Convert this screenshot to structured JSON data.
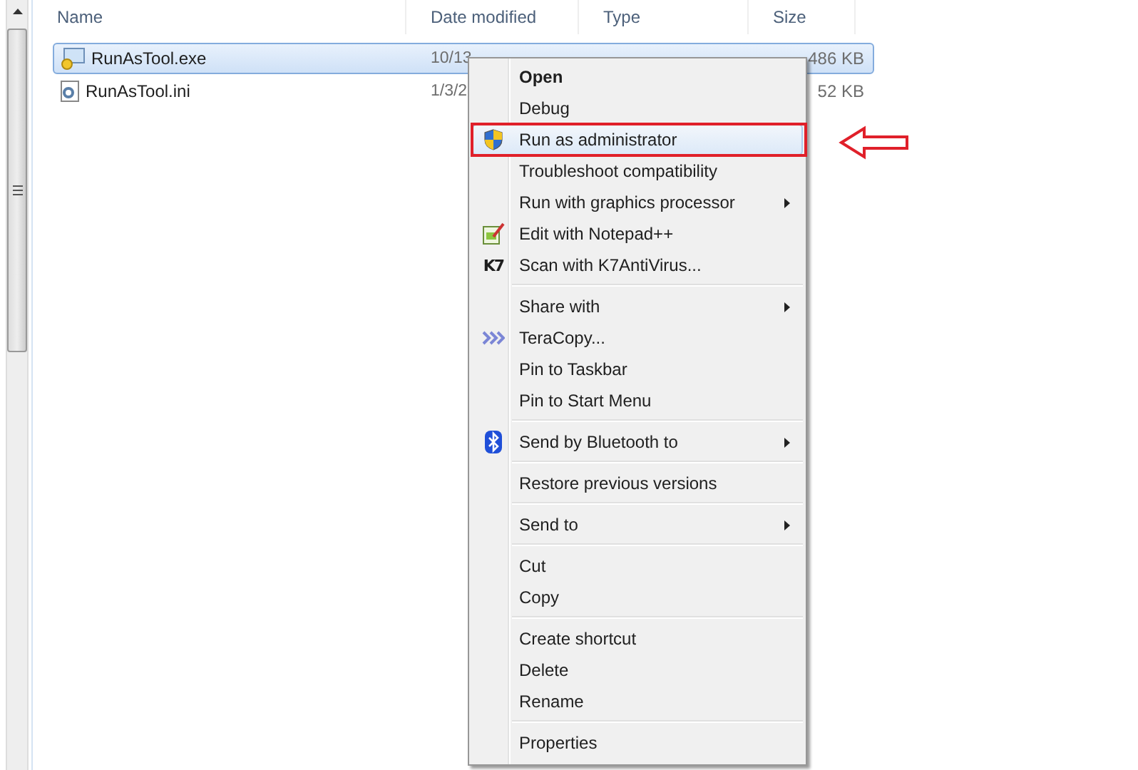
{
  "columns": [
    {
      "label": "Name"
    },
    {
      "label": "Date modified"
    },
    {
      "label": "Type"
    },
    {
      "label": "Size"
    }
  ],
  "files": [
    {
      "name": "RunAsTool.exe",
      "date": "10/13",
      "size": "486 KB",
      "selected": true
    },
    {
      "name": "RunAsTool.ini",
      "date": "1/3/2",
      "size": "52 KB",
      "selected": false
    }
  ],
  "context_menu": [
    {
      "kind": "item",
      "label": "Open",
      "bold": true,
      "submenu": false,
      "selected": false
    },
    {
      "kind": "item",
      "label": "Debug",
      "bold": false,
      "submenu": false,
      "selected": false
    },
    {
      "kind": "item",
      "label": "Run as administrator",
      "bold": false,
      "submenu": false,
      "selected": true
    },
    {
      "kind": "item",
      "label": "Troubleshoot compatibility",
      "bold": false,
      "submenu": false,
      "selected": false
    },
    {
      "kind": "item",
      "label": "Run with graphics processor",
      "bold": false,
      "submenu": true,
      "selected": false
    },
    {
      "kind": "item",
      "label": "Edit with Notepad++",
      "bold": false,
      "submenu": false,
      "selected": false
    },
    {
      "kind": "item",
      "label": "Scan with K7AntiVirus...",
      "badge": "K7",
      "bold": false,
      "submenu": false,
      "selected": false
    },
    {
      "kind": "separator"
    },
    {
      "kind": "item",
      "label": "Share with",
      "bold": false,
      "submenu": true,
      "selected": false
    },
    {
      "kind": "item",
      "label": "TeraCopy...",
      "bold": false,
      "submenu": false,
      "selected": false
    },
    {
      "kind": "item",
      "label": "Pin to Taskbar",
      "bold": false,
      "submenu": false,
      "selected": false
    },
    {
      "kind": "item",
      "label": "Pin to Start Menu",
      "bold": false,
      "submenu": false,
      "selected": false
    },
    {
      "kind": "separator"
    },
    {
      "kind": "item",
      "label": "Send by Bluetooth to",
      "bold": false,
      "submenu": true,
      "selected": false
    },
    {
      "kind": "separator"
    },
    {
      "kind": "item",
      "label": "Restore previous versions",
      "bold": false,
      "submenu": false,
      "selected": false
    },
    {
      "kind": "separator"
    },
    {
      "kind": "item",
      "label": "Send to",
      "bold": false,
      "submenu": true,
      "selected": false
    },
    {
      "kind": "separator"
    },
    {
      "kind": "item",
      "label": "Cut",
      "bold": false,
      "submenu": false,
      "selected": false
    },
    {
      "kind": "item",
      "label": "Copy",
      "bold": false,
      "submenu": false,
      "selected": false
    },
    {
      "kind": "separator"
    },
    {
      "kind": "item",
      "label": "Create shortcut",
      "bold": false,
      "submenu": false,
      "selected": false
    },
    {
      "kind": "item",
      "label": "Delete",
      "bold": false,
      "submenu": false,
      "selected": false
    },
    {
      "kind": "item",
      "label": "Rename",
      "bold": false,
      "submenu": false,
      "selected": false
    },
    {
      "kind": "separator"
    },
    {
      "kind": "item",
      "label": "Properties",
      "bold": false,
      "submenu": false,
      "selected": false
    }
  ]
}
